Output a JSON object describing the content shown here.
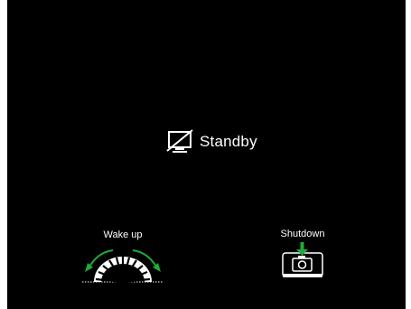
{
  "standby": {
    "label": "Standby",
    "icon": "display-off-icon"
  },
  "actions": {
    "wake_up": {
      "label": "Wake up",
      "icon": "rotate-knob-icon"
    },
    "shutdown": {
      "label": "Shutdown",
      "icon": "press-button-icon"
    }
  },
  "colors": {
    "background": "#000000",
    "text": "#ffffff",
    "accent": "#1faa3a"
  }
}
